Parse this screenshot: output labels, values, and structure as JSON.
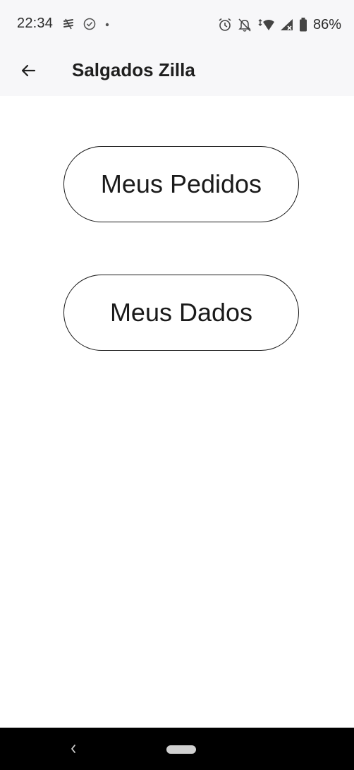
{
  "status_bar": {
    "time": "22:34",
    "left_icons": [
      "notification-app-icon",
      "check-circle-icon",
      "dot-icon"
    ],
    "right_icons": [
      "alarm-icon",
      "muted-bell-icon",
      "wifi-icon",
      "signal-icon",
      "battery-icon"
    ],
    "battery_percent": "86%"
  },
  "app_bar": {
    "title": "Salgados Zilla",
    "back_icon": "arrow-back-icon"
  },
  "main": {
    "buttons": [
      {
        "label": "Meus Pedidos"
      },
      {
        "label": "Meus Dados"
      }
    ]
  },
  "nav_bar": {
    "back_icon": "chevron-left-icon",
    "home_icon": "home-pill-icon"
  },
  "colors": {
    "background": "#ffffff",
    "app_bar": "#f7f7f9",
    "button_border": "#1a1a1a",
    "nav_bar": "#000000"
  }
}
